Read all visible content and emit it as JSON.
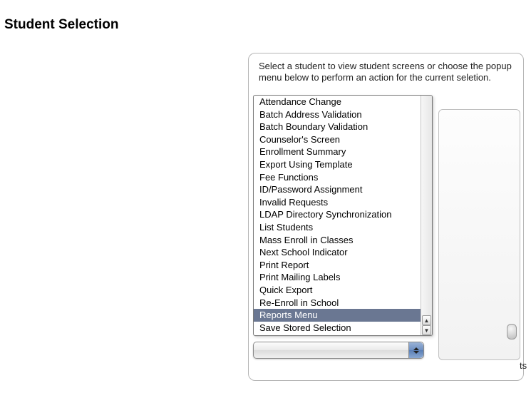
{
  "page": {
    "title": "Student Selection"
  },
  "panel": {
    "instructions": "Select a student to view student screens or choose the popup menu below to perform an action for the current seletion.",
    "partial_label_fragment": "ts"
  },
  "dropdown": {
    "selected_index": 17,
    "items": [
      "Attendance Change",
      "Batch Address Validation",
      "Batch Boundary Validation",
      "Counselor's Screen",
      "Enrollment Summary",
      "Export Using Template",
      "Fee Functions",
      "ID/Password Assignment",
      "Invalid Requests",
      "LDAP Directory Synchronization",
      "List Students",
      "Mass Enroll in Classes",
      "Next School Indicator",
      "Print Report",
      "Print Mailing Labels",
      "Quick Export",
      "Re-Enroll in School",
      "Reports Menu",
      "Save Stored Selection"
    ]
  },
  "popup": {
    "value": ""
  }
}
